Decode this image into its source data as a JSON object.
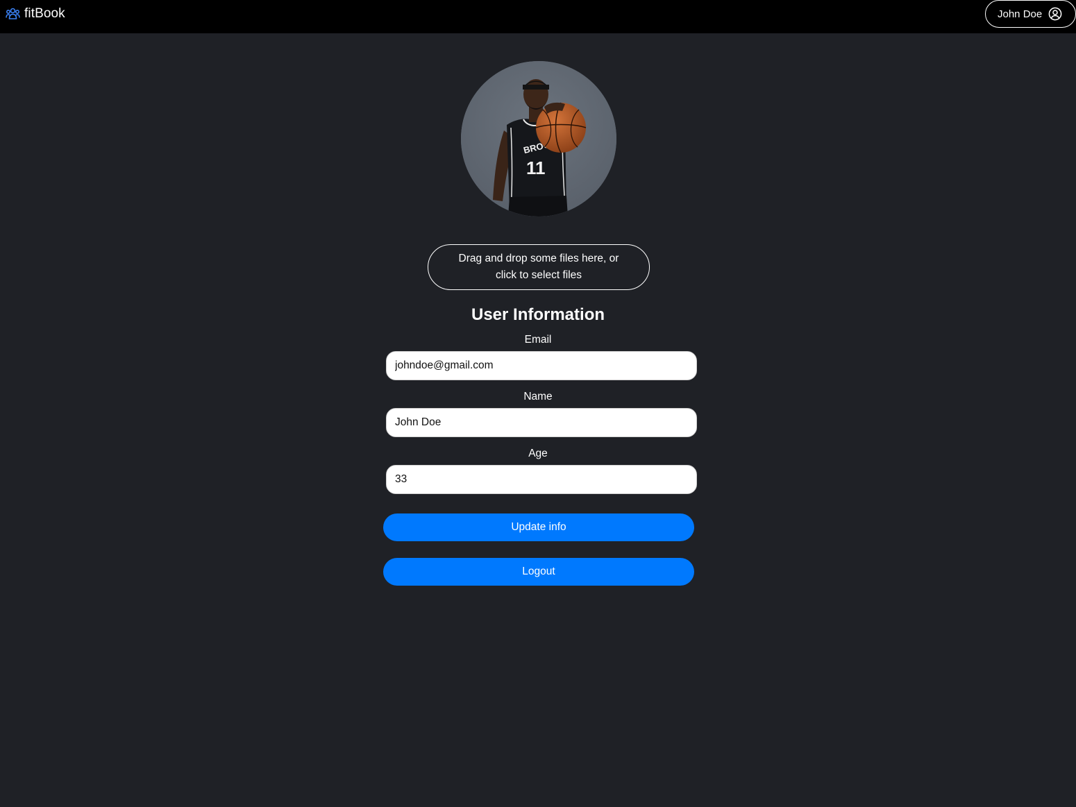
{
  "navbar": {
    "brand": "fitBook",
    "brand_icon": "people-group-icon",
    "user_name": "John Doe",
    "user_icon": "user-circle-icon"
  },
  "profile": {
    "avatar_alt": "Profile photo",
    "dropzone_text": "Drag and drop some files here, or click to select files"
  },
  "form": {
    "title": "User Information",
    "fields": [
      {
        "label": "Email",
        "value": "johndoe@gmail.com"
      },
      {
        "label": "Name",
        "value": "John Doe"
      },
      {
        "label": "Age",
        "value": "33"
      }
    ],
    "update_label": "Update info",
    "logout_label": "Logout"
  },
  "colors": {
    "background": "#1f2126",
    "navbar": "#000000",
    "accent": "#0079fe",
    "brand_icon": "#3b82f6"
  }
}
